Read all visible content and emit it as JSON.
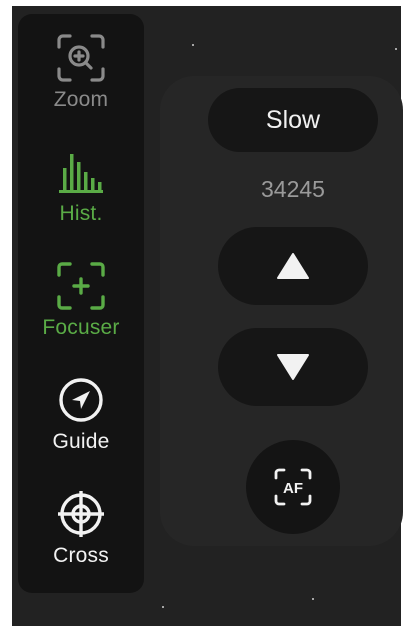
{
  "sidebar": {
    "items": [
      {
        "label": "Zoom",
        "icon": "zoom-icon",
        "color": "#8a8a8a",
        "active": false
      },
      {
        "label": "Hist.",
        "icon": "histogram-icon",
        "color": "#5aab46",
        "active": true
      },
      {
        "label": "Focuser",
        "icon": "focuser-icon",
        "color": "#5aab46",
        "active": true
      },
      {
        "label": "Guide",
        "icon": "guide-icon",
        "color": "#f2f2f2",
        "active": false
      },
      {
        "label": "Cross",
        "icon": "crosshair-icon",
        "color": "#f2f2f2",
        "active": false
      }
    ]
  },
  "focuser": {
    "speed_label": "Slow",
    "position": "34245",
    "up_icon": "triangle-up-icon",
    "down_icon": "triangle-down-icon",
    "autofocus_label": "AF"
  },
  "colors": {
    "accent_green": "#5aab46",
    "background": "#222222",
    "sidebar_bg": "#131313",
    "button_bg": "#161616"
  }
}
